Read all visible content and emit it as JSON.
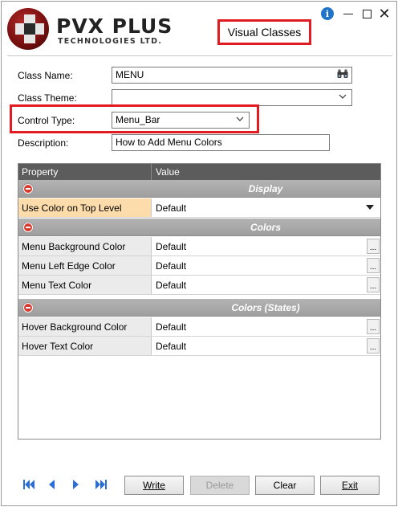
{
  "header": {
    "brand_name": "PVX PLUS",
    "brand_sub": "TECHNOLOGIES LTD.",
    "window_title": "Visual Classes"
  },
  "window_controls": {
    "info": "i",
    "close": "✕"
  },
  "form": {
    "class_name_label": "Class Name:",
    "class_name_value": "MENU",
    "class_theme_label": "Class Theme:",
    "class_theme_value": "",
    "control_type_label": "Control Type:",
    "control_type_value": "Menu_Bar",
    "description_label": "Description:",
    "description_value": "How to Add Menu Colors"
  },
  "grid": {
    "columns": [
      "Property",
      "Value"
    ],
    "categories": [
      {
        "label": "Display",
        "rows": [
          {
            "name": "Use Color on Top Level",
            "value": "Default"
          }
        ]
      },
      {
        "label": "Colors",
        "rows": [
          {
            "name": "Menu Background Color",
            "value": "Default"
          },
          {
            "name": "Menu Left Edge Color",
            "value": "Default"
          },
          {
            "name": "Menu Text Color",
            "value": "Default"
          }
        ]
      },
      {
        "label": "Colors (States)",
        "rows": [
          {
            "name": "Hover Background Color",
            "value": "Default"
          },
          {
            "name": "Hover Text Color",
            "value": "Default"
          }
        ]
      }
    ],
    "ellipsis": "..."
  },
  "footer": {
    "write": "Write",
    "delete": "Delete",
    "clear": "Clear",
    "exit": "Exit"
  },
  "colors": {
    "highlight_red": "#e21b23",
    "grid_header": "#5c5c5c",
    "selected_row": "#fbdcaa",
    "nav_blue": "#2a6ed6"
  }
}
